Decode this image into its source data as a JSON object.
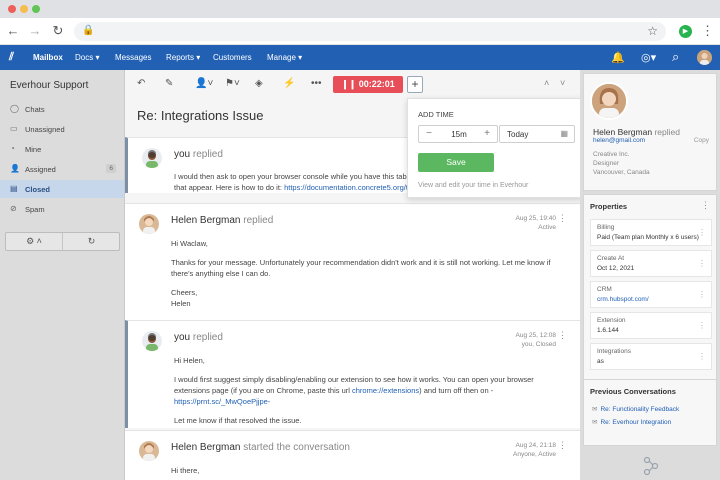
{
  "browser": {
    "dots": [
      "#ee5f5b",
      "#f5bd4f",
      "#61c454"
    ],
    "back_icon": "←",
    "forward_icon": "→",
    "reload_icon": "↻",
    "lock_icon": "🔒",
    "star_icon": "☆",
    "ext_icon": "▶",
    "menu_icon": "⋮"
  },
  "nav": {
    "logo": "⫽",
    "items": [
      "Mailbox",
      "Docs ▾",
      "Messages",
      "Reports ▾",
      "Customers",
      "Manage ▾"
    ],
    "bell_icon": "🔔",
    "globe_icon": "◎▾",
    "search_icon": "⌕",
    "brand_color": "#2260b4"
  },
  "sidebar": {
    "title": "Everhour Support",
    "items": [
      {
        "label": "Chats",
        "icon": "◯",
        "count": ""
      },
      {
        "label": "Unassigned",
        "icon": "▭",
        "count": ""
      },
      {
        "label": "Mine",
        "icon": "◔",
        "count": ""
      },
      {
        "label": "Assigned",
        "icon": "👤",
        "count": "6"
      },
      {
        "label": "Closed",
        "icon": "▤",
        "count": ""
      },
      {
        "label": "Spam",
        "icon": "⊘",
        "count": ""
      }
    ],
    "tools": [
      "⚙ ˄",
      "↻"
    ]
  },
  "toolbar": {
    "icons": [
      "↶",
      "✎",
      "👤˅",
      "⚑˅",
      "◈",
      "⚡",
      "•••"
    ],
    "timer": "❙❙ 00:22:01",
    "plus": "+",
    "up": "˄",
    "down": "˅"
  },
  "subject": "Re: Integrations Issue",
  "messages": [
    {
      "name": "you",
      "action": "replied",
      "date": "",
      "status": "",
      "body": [
        "I would then ask to open your browser console while you have this tab ope",
        "that appear. Here is how to do it: "
      ],
      "link": "https://documentation.concrete5.org/tuto"
    },
    {
      "name": "Helen Bergman",
      "action": "replied",
      "date": "Aug 25, 19:40",
      "status": "Active",
      "p1": "Hi Waclaw,",
      "p2": "Thanks for your message. Unfortunately your recommendation didn't work and it is still not working. Let me know if there's anything else I can do.",
      "p3a": "Cheers,",
      "p3b": "Helen"
    },
    {
      "name": "you",
      "action": "replied",
      "date": "Aug 25, 12:08",
      "status": "you, Closed",
      "p1": "Hi Helen,",
      "p2a": "I would first suggest simply disabling/enabling our extension to see how it works. You can open your browser extensions page (if you are on Chrome, paste this url ",
      "p2link1": "chrome://extensions",
      "p2b": ") and turn off then on - ",
      "p2link2": "https://prnt.sc/_MwQoePjjpe-",
      "p3": "Let me know if that resolved the issue."
    },
    {
      "name": "Helen Bergman",
      "action": "started the conversation",
      "date": "Aug 24, 21:18",
      "status": "Anyone, Active",
      "p1": "Hi there,"
    }
  ],
  "popover": {
    "title": "ADD TIME",
    "minus": "−",
    "plus": "+",
    "duration": "15m",
    "date": "Today",
    "cal_icon": "▦",
    "save": "Save",
    "hint": "View and edit your time in Everhour",
    "save_color": "#5cb860"
  },
  "contact": {
    "name": "Helen Bergman",
    "action": "replied",
    "email": "helen@gmail.com",
    "copy": "Copy",
    "company": "Creative Inc.",
    "title": "Designer",
    "location": "Vancouver, Canada"
  },
  "properties": {
    "title": "Properties",
    "items": [
      {
        "key": "Billing",
        "value": "Paid (Team plan Monthly x 6 users)",
        "link": false
      },
      {
        "key": "Create At",
        "value": "Oct 12, 2021",
        "link": false
      },
      {
        "key": "CRM",
        "value": "crm.hubspot.com/",
        "link": true
      },
      {
        "key": "Extension",
        "value": "1.6.144",
        "link": false
      },
      {
        "key": "Integrations",
        "value": "as",
        "link": false
      }
    ]
  },
  "previous": {
    "title": "Previous Conversations",
    "items": [
      "Re: Functionality Feedback",
      "Re: Everhour Integration"
    ]
  }
}
